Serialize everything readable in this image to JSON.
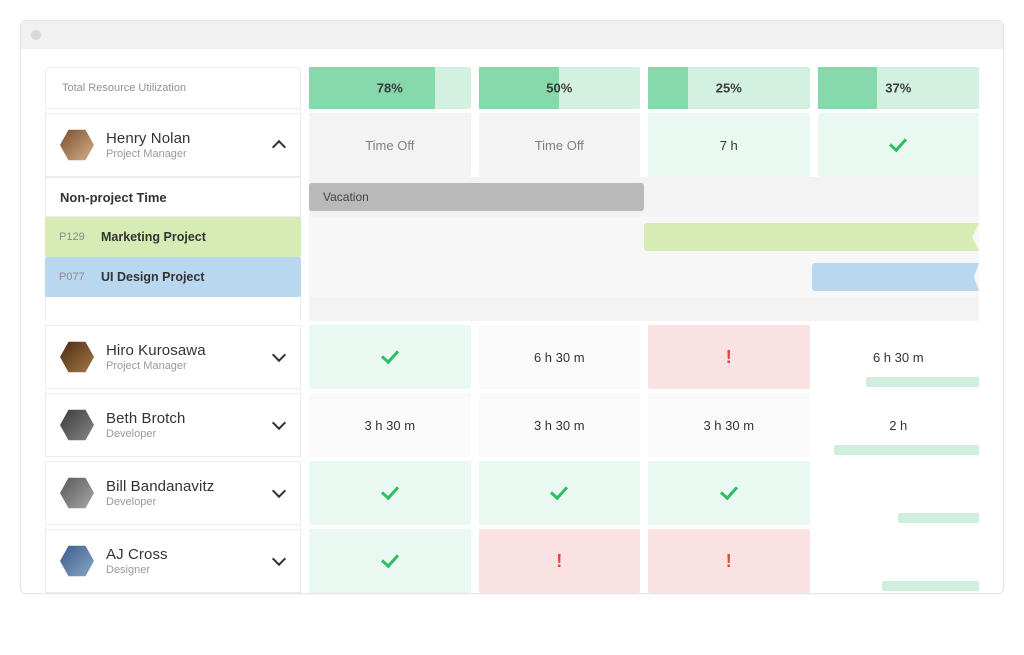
{
  "header": {
    "utilization_label": "Total Resource Utilization",
    "columns": [
      {
        "percent": "78%",
        "width": 78
      },
      {
        "percent": "50%",
        "width": 50
      },
      {
        "percent": "25%",
        "width": 25
      },
      {
        "percent": "37%",
        "width": 37
      }
    ]
  },
  "people": [
    {
      "name": "Henry Nolan",
      "role": "Project Manager",
      "expanded": true,
      "cells": [
        {
          "type": "timeoff",
          "text": "Time Off"
        },
        {
          "type": "timeoff",
          "text": "Time Off"
        },
        {
          "type": "green",
          "text": "7 h"
        },
        {
          "type": "greencheck",
          "text": ""
        }
      ],
      "sub": {
        "nonproject_label": "Non-project Time",
        "vacation_label": "Vacation",
        "projects": [
          {
            "code": "P129",
            "name": "Marketing Project",
            "color": "marketing"
          },
          {
            "code": "P077",
            "name": "UI Design Project",
            "color": "ui"
          }
        ]
      }
    },
    {
      "name": "Hiro Kurosawa",
      "role": "Project Manager",
      "expanded": false,
      "cells": [
        {
          "type": "greencheck",
          "text": ""
        },
        {
          "type": "plain",
          "text": "6 h 30 m"
        },
        {
          "type": "red",
          "text": "!"
        },
        {
          "type": "plainwhite",
          "text": "6 h 30 m"
        }
      ]
    },
    {
      "name": "Beth Brotch",
      "role": "Developer",
      "expanded": false,
      "cells": [
        {
          "type": "plain",
          "text": "3 h 30 m"
        },
        {
          "type": "plain",
          "text": "3 h 30 m"
        },
        {
          "type": "plain",
          "text": "3 h 30 m"
        },
        {
          "type": "plainwhite",
          "text": "2 h"
        }
      ]
    },
    {
      "name": "Bill Bandanavitz",
      "role": "Developer",
      "expanded": false,
      "cells": [
        {
          "type": "greencheck",
          "text": ""
        },
        {
          "type": "greencheck",
          "text": ""
        },
        {
          "type": "greencheck",
          "text": ""
        },
        {
          "type": "plainwhite",
          "text": ""
        }
      ]
    },
    {
      "name": "AJ Cross",
      "role": "Designer",
      "expanded": false,
      "cells": [
        {
          "type": "greencheck",
          "text": ""
        },
        {
          "type": "red",
          "text": "!"
        },
        {
          "type": "red",
          "text": "!"
        },
        {
          "type": "plainwhite",
          "text": ""
        }
      ]
    }
  ]
}
